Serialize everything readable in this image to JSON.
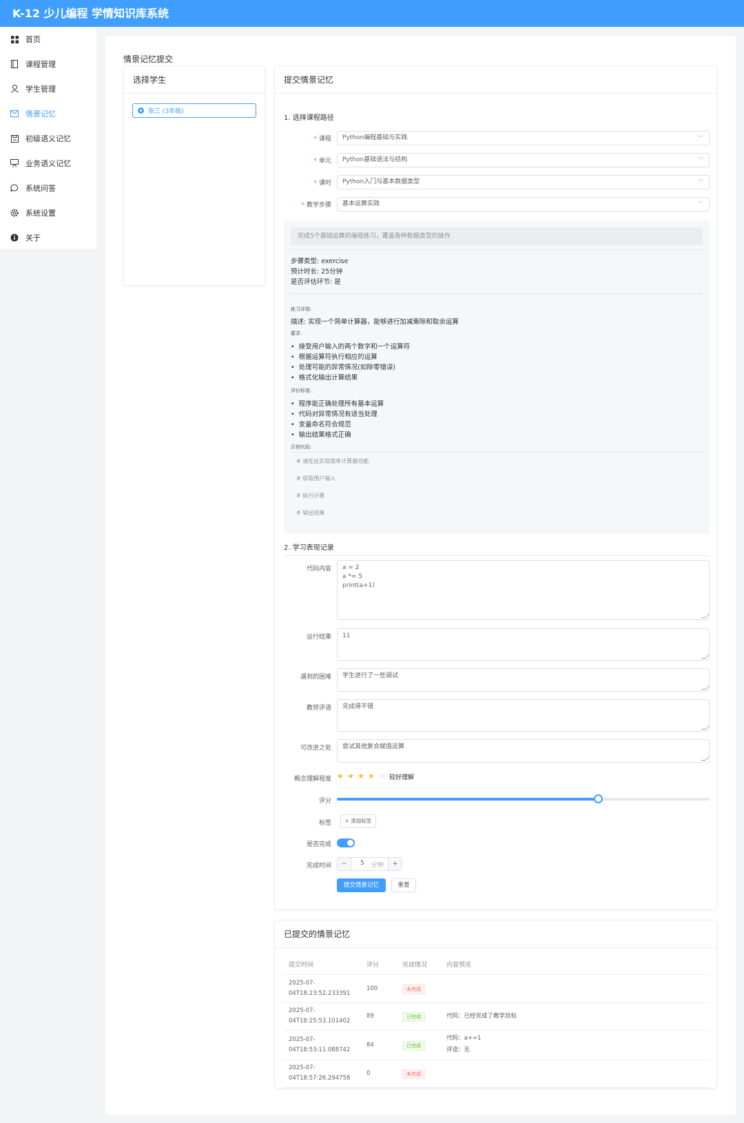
{
  "app": {
    "title": "K-12 少儿编程 学情知识库系统"
  },
  "sidebar": {
    "items": [
      {
        "label": "首页",
        "icon": "grid-icon"
      },
      {
        "label": "课程管理",
        "icon": "notebook-icon"
      },
      {
        "label": "学生管理",
        "icon": "user-icon"
      },
      {
        "label": "情景记忆",
        "icon": "mail-icon",
        "active": true
      },
      {
        "label": "初级语义记忆",
        "icon": "save-icon"
      },
      {
        "label": "业务语义记忆",
        "icon": "presentation-icon"
      },
      {
        "label": "系统问答",
        "icon": "chat-icon"
      },
      {
        "label": "系统设置",
        "icon": "gear-icon"
      },
      {
        "label": "关于",
        "icon": "info-icon"
      }
    ]
  },
  "page": {
    "title": "情景记忆提交"
  },
  "student_panel": {
    "title": "选择学生",
    "students": [
      {
        "label": "张三 (3年级)",
        "selected": true
      }
    ]
  },
  "form": {
    "title": "提交情景记忆",
    "section1": "1. 选择课程路径",
    "fields": {
      "course": {
        "label": "课程",
        "value": "Python编程基础与实践"
      },
      "unit": {
        "label": "单元",
        "value": "Python基础语法与结构"
      },
      "lesson": {
        "label": "课时",
        "value": "Python入门与基本数据类型"
      },
      "step": {
        "label": "教学步骤",
        "value": "基本运算实践"
      }
    },
    "info": {
      "description": "完成5个基础运算的编程练习，覆盖各种数据类型的操作",
      "step_type": "步骤类型: exercise",
      "duration": "预计时长: 25分钟",
      "is_assessment": "是否评估环节: 是",
      "exercise_label": "练习详情:",
      "exercise_desc": "描述: 实现一个简单计算器，能够进行加减乘除和取余运算",
      "req_label": "要求:",
      "requirements": [
        "接受用户输入的两个数字和一个运算符",
        "根据运算符执行相应的运算",
        "处理可能的异常情况(如除零错误)",
        "格式化输出计算结果"
      ],
      "criteria_label": "评价标准:",
      "criteria": [
        "程序能正确处理所有基本运算",
        "代码对异常情况有适当处理",
        "变量命名符合规范",
        "输出结果格式正确"
      ],
      "code_label": "示例代码:",
      "code_lines": [
        "# 请在此实现简单计算器功能",
        "# 获取用户输入",
        "# 执行计算",
        "# 输出结果"
      ]
    },
    "section2": "2. 学习表现记录",
    "code_content": {
      "label": "代码内容",
      "value": "a = 2\na *= 5\nprint(a+1)"
    },
    "run_result": {
      "label": "运行结果",
      "value": "11"
    },
    "difficulty": {
      "label": "遇到的困难",
      "value": "学生进行了一些调试"
    },
    "teacher_comment": {
      "label": "教师评语",
      "value": "完成得不错"
    },
    "improvement": {
      "label": "可改进之处",
      "value": "尝试其他复合赋值运算"
    },
    "understanding": {
      "label": "概念理解程度",
      "stars": 4,
      "max": 5,
      "text": "较好理解",
      "star_color": "#f7ba2a"
    },
    "score": {
      "label": "评分",
      "value": 70,
      "max": 100
    },
    "tags": {
      "label": "标签",
      "add_label": "+ 添加标签"
    },
    "completed": {
      "label": "是否完成",
      "value": true
    },
    "completion_time": {
      "label": "完成时间",
      "value": "5",
      "unit": "分钟",
      "minus": "−",
      "plus": "+"
    },
    "submit_label": "提交情景记忆",
    "reset_label": "重置"
  },
  "submitted": {
    "title": "已提交的情景记忆",
    "columns": [
      "提交时间",
      "评分",
      "完成情况",
      "内容预览"
    ],
    "rows": [
      {
        "time_date": "2025-07-",
        "time_rest": "04T18:23:52.233391",
        "score": "100",
        "status": "未完成",
        "done": false,
        "preview": [
          "",
          ""
        ]
      },
      {
        "time_date": "2025-07-",
        "time_rest": "04T18:25:53.101402",
        "score": "89",
        "status": "已完成",
        "done": true,
        "preview": [
          "代码：已经完成了教学目标",
          ""
        ]
      },
      {
        "time_date": "2025-07-",
        "time_rest": "04T18:53:11.088742",
        "score": "84",
        "status": "已完成",
        "done": true,
        "preview": [
          "代码：a+=1",
          "评语：无"
        ]
      },
      {
        "time_date": "2025-07-",
        "time_rest": "04T18:57:26.294758",
        "score": "0",
        "status": "未完成",
        "done": false,
        "preview": [
          "",
          ""
        ]
      }
    ]
  },
  "colors": {
    "primary": "#409eff",
    "danger": "#f56c6c",
    "success": "#67c23a"
  }
}
